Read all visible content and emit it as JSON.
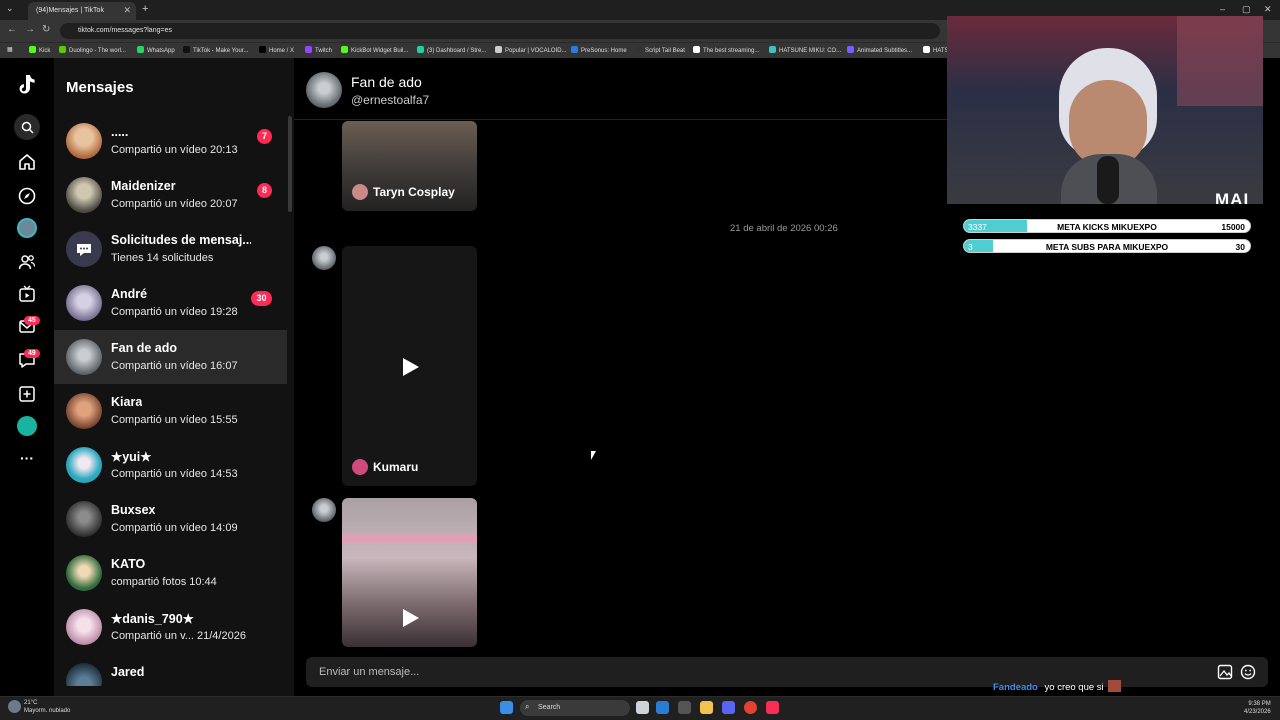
{
  "browser": {
    "tab_title": "(94)Mensajes | TikTok",
    "tab_close": "✕",
    "new_tab": "+",
    "url": "tiktok.com/messages?lang=es",
    "bookmarks": [
      {
        "label": "Kick",
        "color": "#53fc18"
      },
      {
        "label": "Duolingo - The worl...",
        "color": "#58cc02"
      },
      {
        "label": "WhatsApp",
        "color": "#25d366"
      },
      {
        "label": "TikTok - Make Your...",
        "color": "#111111"
      },
      {
        "label": "Home / X",
        "color": "#000000"
      },
      {
        "label": "Twitch",
        "color": "#9146ff"
      },
      {
        "label": "KickBot Widget Buil...",
        "color": "#53fc18"
      },
      {
        "label": "(3) Dashboard / Stre...",
        "color": "#1dd1a1"
      },
      {
        "label": "Popular | VOCALOID...",
        "color": "#cccccc"
      },
      {
        "label": "PreSonus: Home",
        "color": "#2c7be5"
      },
      {
        "label": "Script Tail Beat",
        "color": "#333333"
      },
      {
        "label": "The best streaming...",
        "color": "#ffffff"
      },
      {
        "label": "HATSUNE MIKU: CO...",
        "color": "#39c5bb"
      },
      {
        "label": "Animated Subtitles...",
        "color": "#7b5cff"
      },
      {
        "label": "HATS",
        "color": "#ffffff"
      }
    ]
  },
  "rail": {
    "badge_inbox": "45",
    "badge_messages": "49"
  },
  "list": {
    "title": "Mensajes",
    "conversations": [
      {
        "name": ".....",
        "sub": "Compartió un vídeo 20:13",
        "badge": "7",
        "avatar": "#c7926b"
      },
      {
        "name": "Maidenizer",
        "sub": "Compartió un vídeo 20:07",
        "badge": "8",
        "avatar": "#6d6a5e"
      },
      {
        "name": "Solicitudes de mensaj...",
        "sub": "Tienes 14 solicitudes",
        "badge": "",
        "avatar": "#3d3d55"
      },
      {
        "name": "André",
        "sub": "Compartió un vídeo 19:28",
        "badge": "30",
        "avatar": "#8d86a8"
      },
      {
        "name": "Fan de ado",
        "sub": "Compartió un vídeo 16:07",
        "badge": "",
        "avatar": "#8a9096"
      },
      {
        "name": "Kiara",
        "sub": "Compartió un vídeo 15:55",
        "badge": "",
        "avatar": "#a0603e"
      },
      {
        "name": "★yui★",
        "sub": "Compartió un vídeo 14:53",
        "badge": "",
        "avatar": "#3ab5c8"
      },
      {
        "name": "Buxsex",
        "sub": "Compartió un vídeo 14:09",
        "badge": "",
        "avatar": "#4a4a4a"
      },
      {
        "name": "KATO",
        "sub": "compartió fotos 10:44",
        "badge": "",
        "avatar": "#3f7a4a"
      },
      {
        "name": "★danis_790★",
        "sub": "Compartió un v... 21/4/2026",
        "badge": "",
        "avatar": "#d9a7b8"
      },
      {
        "name": "Jared",
        "sub": "",
        "badge": "",
        "avatar": "#2e4a5e"
      }
    ]
  },
  "chat": {
    "name": "Fan de ado",
    "handle": "@ernestoalfa7",
    "timestamp": "21 de abril de 2026 00:26",
    "videos": [
      {
        "author": "Taryn Cosplay"
      },
      {
        "author": "Kumaru"
      },
      {
        "author": ""
      }
    ],
    "input_placeholder": "Enviar un mensaje..."
  },
  "overlay": {
    "streamer_tag": "MAI",
    "goals": [
      {
        "label": "META KICKS MIKUEXPO",
        "current": "3337",
        "target": "15000",
        "progress": 0.222
      },
      {
        "label": "META SUBS PARA MIKUEXPO",
        "current": "3",
        "target": "30",
        "progress": 0.1
      }
    ],
    "chat_user": "Fandeado",
    "chat_message": "yo creo que si"
  },
  "taskbar": {
    "temp": "21°C",
    "weather": "Mayorm. nublado",
    "search": "Search",
    "time": "9:38 PM",
    "date": "4/23/2026"
  }
}
